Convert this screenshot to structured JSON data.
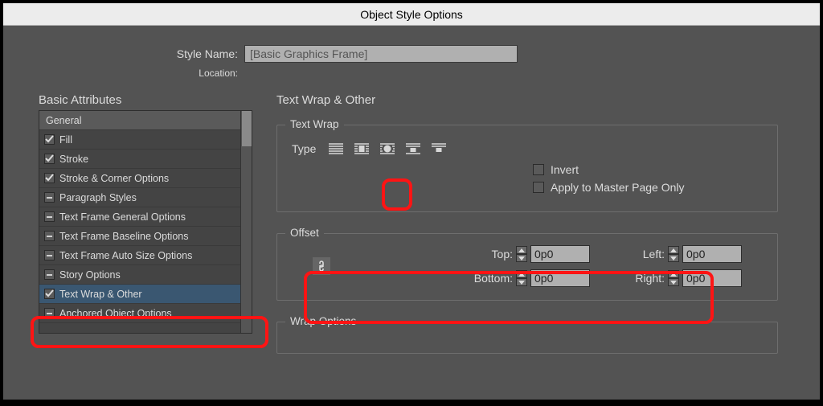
{
  "window_title": "Object Style Options",
  "style_name": {
    "label": "Style Name:",
    "value": "[Basic Graphics Frame]"
  },
  "location_label": "Location:",
  "sidebar": {
    "heading": "Basic Attributes",
    "items": [
      {
        "label": "General",
        "state": "none",
        "selected": false
      },
      {
        "label": "Fill",
        "state": "check",
        "selected": false
      },
      {
        "label": "Stroke",
        "state": "check",
        "selected": false
      },
      {
        "label": "Stroke & Corner Options",
        "state": "check",
        "selected": false
      },
      {
        "label": "Paragraph Styles",
        "state": "dash",
        "selected": false
      },
      {
        "label": "Text Frame General Options",
        "state": "dash",
        "selected": false
      },
      {
        "label": "Text Frame Baseline Options",
        "state": "dash",
        "selected": false
      },
      {
        "label": "Text Frame Auto Size Options",
        "state": "dash",
        "selected": false
      },
      {
        "label": "Story Options",
        "state": "dash",
        "selected": false
      },
      {
        "label": "Text Wrap & Other",
        "state": "check",
        "selected": true
      },
      {
        "label": "Anchored Object Options",
        "state": "dash",
        "selected": false
      }
    ]
  },
  "main": {
    "heading": "Text Wrap & Other",
    "text_wrap": {
      "legend": "Text Wrap",
      "type_label": "Type",
      "wrap_mode_selected": 1,
      "invert": {
        "label": "Invert",
        "checked": false
      },
      "master_only": {
        "label": "Apply to Master Page Only",
        "checked": false
      }
    },
    "offset": {
      "legend": "Offset",
      "top": {
        "label": "Top:",
        "value": "0p0"
      },
      "bottom": {
        "label": "Bottom:",
        "value": "0p0"
      },
      "left": {
        "label": "Left:",
        "value": "0p0"
      },
      "right": {
        "label": "Right:",
        "value": "0p0"
      },
      "linked": true
    },
    "wrap_options": {
      "legend": "Wrap Options"
    }
  }
}
